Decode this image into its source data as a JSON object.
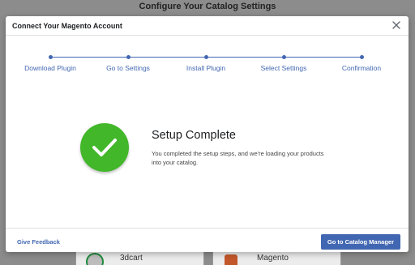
{
  "background": {
    "title": "Configure Your Catalog Settings",
    "cards": [
      {
        "label": "3dcart",
        "icon": "cart-icon"
      },
      {
        "label": "Magento",
        "icon": "magento-logo-icon"
      }
    ]
  },
  "modal": {
    "title": "Connect Your Magento Account",
    "close_icon": "close-icon",
    "steps": [
      {
        "label": "Download Plugin"
      },
      {
        "label": "Go to Settings"
      },
      {
        "label": "Install Plugin"
      },
      {
        "label": "Select Settings"
      },
      {
        "label": "Confirmation"
      }
    ],
    "status": {
      "icon": "checkmark-icon",
      "title": "Setup Complete",
      "message": "You completed the setup steps, and we're loading your products into your catalog."
    },
    "footer": {
      "feedback_label": "Give Feedback",
      "primary_label": "Go to Catalog Manager"
    }
  },
  "colors": {
    "accent": "#4267b2",
    "success": "#42b72a"
  }
}
